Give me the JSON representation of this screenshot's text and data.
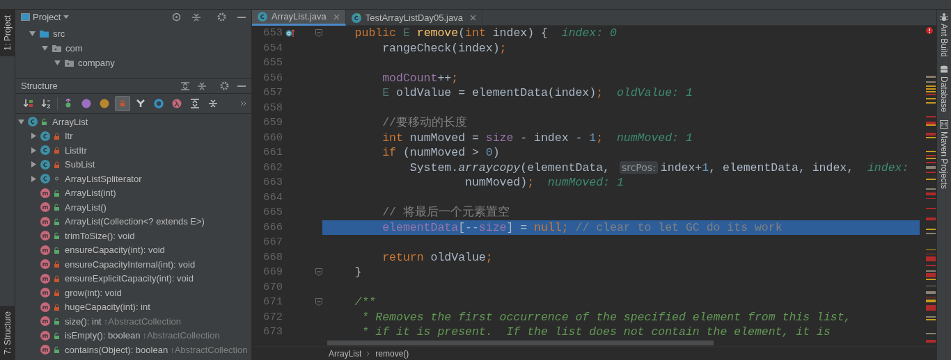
{
  "left_strip": {
    "tabs": [
      {
        "label": "1: Project",
        "selected": true
      },
      {
        "label": "7: Structure",
        "selected": true
      }
    ]
  },
  "project": {
    "title": "Project",
    "tree": [
      {
        "label": "src",
        "kind": "source",
        "expanded": true,
        "children": [
          {
            "label": "com",
            "kind": "package",
            "expanded": true,
            "children": [
              {
                "label": "company",
                "kind": "package",
                "expanded": true
              }
            ]
          }
        ]
      }
    ]
  },
  "structure": {
    "title": "Structure",
    "toolbar": [
      {
        "on": false
      },
      {
        "on": false
      },
      {
        "on": false
      },
      {
        "on": false
      },
      {
        "on": false
      },
      {
        "on": true
      },
      {
        "on": false
      },
      {
        "on": false
      },
      {
        "on": false
      },
      {
        "on": false
      },
      {
        "on": false
      }
    ],
    "tree": [
      {
        "label": "ArrayList",
        "kind": "class-public",
        "expanded": true,
        "children": [
          {
            "label": "Itr",
            "kind": "class-private",
            "expanded": false
          },
          {
            "label": "ListItr",
            "kind": "class-private",
            "expanded": false
          },
          {
            "label": "SubList",
            "kind": "class-private",
            "expanded": false
          },
          {
            "label": "ArrayListSpliterator",
            "kind": "class-package",
            "expanded": false
          },
          {
            "label": "ArrayList(int)",
            "kind": "method-public"
          },
          {
            "label": "ArrayList()",
            "kind": "method-public"
          },
          {
            "label": "ArrayList(Collection<? extends E>)",
            "kind": "method-public"
          },
          {
            "label": "trimToSize(): void",
            "kind": "method-public"
          },
          {
            "label": "ensureCapacity(int): void",
            "kind": "method-public"
          },
          {
            "label": "ensureCapacityInternal(int): void",
            "kind": "method-private"
          },
          {
            "label": "ensureExplicitCapacity(int): void",
            "kind": "method-private"
          },
          {
            "label": "grow(int): void",
            "kind": "method-private"
          },
          {
            "label": "hugeCapacity(int): int",
            "kind": "method-private"
          },
          {
            "label": "size(): int",
            "kind": "method-public",
            "inherited": "↑AbstractCollection"
          },
          {
            "label": "isEmpty(): boolean",
            "kind": "method-public",
            "inherited": "↑AbstractCollection"
          },
          {
            "label": "contains(Object): boolean",
            "kind": "method-public",
            "inherited": "↑AbstractCollection"
          }
        ]
      }
    ]
  },
  "tabs": [
    {
      "label": "ArrayList.java",
      "selected": true,
      "kind": "class"
    },
    {
      "label": "TestArrayListDay05.java",
      "selected": false,
      "kind": "runnable"
    }
  ],
  "editor": {
    "lines": [
      {
        "number": "653",
        "highlighted": false,
        "fold": true,
        "override": true,
        "tokens": [
          {
            "t": "    public",
            "kind": "kw"
          },
          {
            "t": " E ",
            "kind": "type"
          },
          {
            "t": "remove",
            "kind": "method"
          },
          {
            "t": "(",
            "kind": "plain"
          },
          {
            "t": "int",
            "kind": "kw"
          },
          {
            "t": " index) {",
            "kind": "plain"
          },
          {
            "t": "  index: 0",
            "kind": "hint"
          }
        ]
      },
      {
        "number": "654",
        "highlighted": false,
        "fold": false,
        "override": false,
        "tokens": [
          {
            "t": "        rangeCheck(index)",
            "kind": "plain"
          },
          {
            "t": ";",
            "kind": "kw"
          }
        ]
      },
      {
        "number": "655",
        "highlighted": false,
        "fold": false,
        "override": false
      },
      {
        "number": "656",
        "highlighted": false,
        "fold": false,
        "override": false,
        "tokens": [
          {
            "t": "        modCount",
            "kind": "field"
          },
          {
            "t": "++",
            "kind": "plain"
          },
          {
            "t": ";",
            "kind": "kw"
          }
        ]
      },
      {
        "number": "657",
        "highlighted": false,
        "fold": false,
        "override": false,
        "tokens": [
          {
            "t": "        E",
            "kind": "type"
          },
          {
            "t": " oldValue = elementData(index)",
            "kind": "plain"
          },
          {
            "t": ";",
            "kind": "kw"
          },
          {
            "t": "  oldValue: 1",
            "kind": "hint"
          }
        ]
      },
      {
        "number": "658",
        "highlighted": false,
        "fold": false,
        "override": false
      },
      {
        "number": "659",
        "highlighted": false,
        "fold": false,
        "override": false,
        "tokens": [
          {
            "t": "        //要移动的长度",
            "kind": "comment"
          }
        ]
      },
      {
        "number": "660",
        "highlighted": false,
        "fold": false,
        "override": false,
        "tokens": [
          {
            "t": "        int",
            "kind": "kw"
          },
          {
            "t": " numMoved = ",
            "kind": "plain"
          },
          {
            "t": "size",
            "kind": "field"
          },
          {
            "t": " - index - ",
            "kind": "plain"
          },
          {
            "t": "1",
            "kind": "num"
          },
          {
            "t": ";",
            "kind": "kw"
          },
          {
            "t": "  numMoved: 1",
            "kind": "hint"
          }
        ]
      },
      {
        "number": "661",
        "highlighted": false,
        "fold": false,
        "override": false,
        "tokens": [
          {
            "t": "        if",
            "kind": "kw"
          },
          {
            "t": " (numMoved > ",
            "kind": "plain"
          },
          {
            "t": "0",
            "kind": "num"
          },
          {
            "t": ")",
            "kind": "plain"
          }
        ]
      },
      {
        "number": "662",
        "highlighted": false,
        "fold": false,
        "override": false,
        "tokens": [
          {
            "t": "            System.",
            "kind": "plain"
          },
          {
            "t": "arraycopy",
            "kind": "static"
          },
          {
            "t": "(elementData, ",
            "kind": "plain"
          },
          {
            "t": "srcPos:",
            "kind": "param"
          },
          {
            "t": "index+",
            "kind": "plain"
          },
          {
            "t": "1",
            "kind": "num"
          },
          {
            "t": ", elementData, index,",
            "kind": "plain"
          },
          {
            "t": "  index:",
            "kind": "hint"
          }
        ]
      },
      {
        "number": "663",
        "highlighted": false,
        "fold": false,
        "override": false,
        "tokens": [
          {
            "t": "                    numMoved)",
            "kind": "plain"
          },
          {
            "t": ";",
            "kind": "kw"
          },
          {
            "t": "  numMoved: 1",
            "kind": "hint"
          }
        ]
      },
      {
        "number": "664",
        "highlighted": false,
        "fold": false,
        "override": false
      },
      {
        "number": "665",
        "highlighted": false,
        "fold": false,
        "override": false,
        "tokens": [
          {
            "t": "        // 将最后一个元素置空",
            "kind": "comment"
          }
        ]
      },
      {
        "number": "666",
        "highlighted": true,
        "fold": false,
        "override": false,
        "tokens": [
          {
            "t": "        elementData",
            "kind": "field"
          },
          {
            "t": "[--",
            "kind": "plain"
          },
          {
            "t": "size",
            "kind": "field"
          },
          {
            "t": "] = ",
            "kind": "plain"
          },
          {
            "t": "null",
            "kind": "kw"
          },
          {
            "t": ";",
            "kind": "kw"
          },
          {
            "t": " // clear to let GC do its work",
            "kind": "comment"
          }
        ]
      },
      {
        "number": "667",
        "highlighted": false,
        "fold": false,
        "override": false
      },
      {
        "number": "668",
        "highlighted": false,
        "fold": false,
        "override": false,
        "tokens": [
          {
            "t": "        return",
            "kind": "kw"
          },
          {
            "t": " oldValue",
            "kind": "plain"
          },
          {
            "t": ";",
            "kind": "kw"
          }
        ]
      },
      {
        "number": "669",
        "highlighted": false,
        "fold": true,
        "override": false,
        "tokens": [
          {
            "t": "    }",
            "kind": "plain"
          }
        ]
      },
      {
        "number": "670",
        "highlighted": false,
        "fold": false,
        "override": false
      },
      {
        "number": "671",
        "highlighted": false,
        "fold": true,
        "override": false,
        "tokens": [
          {
            "t": "    /**",
            "kind": "doc"
          }
        ]
      },
      {
        "number": "672",
        "highlighted": false,
        "fold": false,
        "override": false,
        "tokens": [
          {
            "t": "     * Removes the first occurrence of the specified element from this list,",
            "kind": "doc"
          }
        ]
      },
      {
        "number": "673",
        "highlighted": false,
        "fold": false,
        "override": false,
        "tokens": [
          {
            "t": "     * if it is present.  If the list does not contain the element, it is",
            "kind": "doc"
          }
        ]
      }
    ]
  },
  "breadcrumb": [
    "ArrayList",
    "remove()"
  ],
  "right_strip": {
    "tabs": [
      {
        "label": "Ant Build",
        "kind": "ant"
      },
      {
        "label": "Database",
        "kind": "database"
      },
      {
        "label": "Maven Projects",
        "kind": "maven"
      }
    ]
  }
}
